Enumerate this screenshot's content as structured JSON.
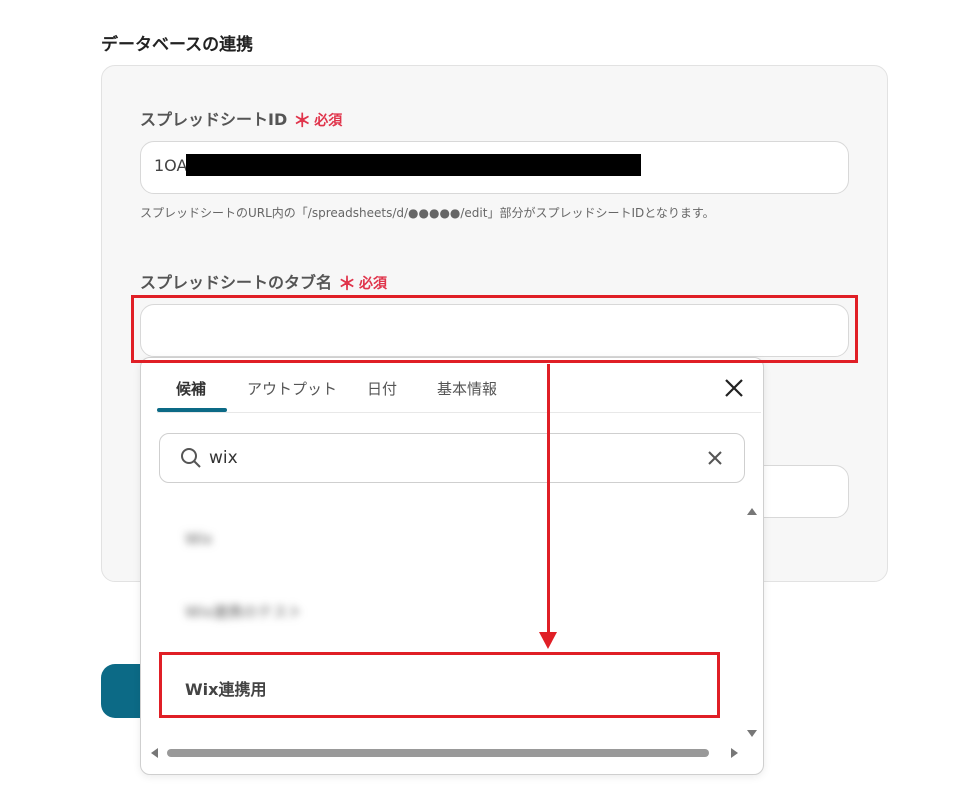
{
  "section_title": "データベースの連携",
  "fields": {
    "spreadsheet_id": {
      "label": "スプレッドシートID",
      "required_mark": "＊",
      "required_text": "必須",
      "value": "1OA",
      "help": "スプレッドシートのURL内の「/spreadsheets/d/●●●●●/edit」部分がスプレッドシートIDとなります。"
    },
    "tab_name": {
      "label": "スプレッドシートのタブ名",
      "required_mark": "＊",
      "required_text": "必須",
      "value": ""
    }
  },
  "popup": {
    "tabs": [
      "候補",
      "アウトプット",
      "日付",
      "基本情報"
    ],
    "active_tab": "候補",
    "search_value": "wix",
    "options": [
      "Wix",
      "Wix連携のテスト",
      "Wix連携用"
    ]
  },
  "colors": {
    "accent": "#0c6a86",
    "highlight": "#e01f26",
    "required": "#e0344b"
  }
}
